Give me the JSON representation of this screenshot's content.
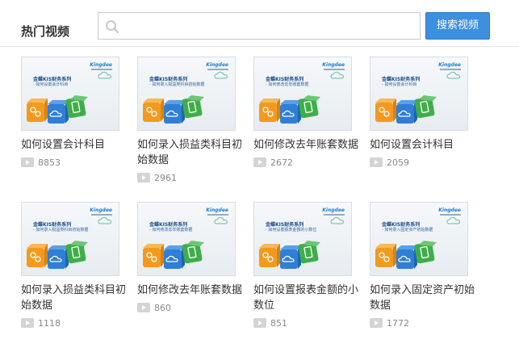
{
  "header": {
    "section_title": "热门视频",
    "search_placeholder": "",
    "search_button": "搜索视频"
  },
  "thumbnail": {
    "brand": "Kingdee",
    "series": "金蝶KIS财务系列",
    "icon_names": [
      "cloud-icon",
      "orange-cube-icon",
      "blue-cube-icon",
      "green-cube-icon"
    ]
  },
  "videos": [
    {
      "title": "如何设置会计科目",
      "subtitle": "- 如何设置会计科目",
      "views": "8853"
    },
    {
      "title": "如何录入损益类科目初始数据",
      "subtitle": "- 如何录入损益类科目初始数据",
      "views": "2961"
    },
    {
      "title": "如何修改去年账套数据",
      "subtitle": "- 如何修改去年账套数据",
      "views": "2672"
    },
    {
      "title": "如何设置会计科目",
      "subtitle": "- 如何设置会计科目",
      "views": "2059"
    },
    {
      "title": "如何录入损益类科目初始数据",
      "subtitle": "- 如何录入损益类科目初始数据",
      "views": "1118"
    },
    {
      "title": "如何修改去年账套数据",
      "subtitle": "- 如何修改去年账套数据",
      "views": "860"
    },
    {
      "title": "如何设置报表金额的小数位",
      "subtitle": "- 如何设置报表金额的小数位",
      "views": "851"
    },
    {
      "title": "如何录入固定资产初始数据",
      "subtitle": "- 如何录入固定资产初始数据",
      "views": "1772"
    }
  ],
  "colors": {
    "accent": "#3d8fe0",
    "cube_orange": "#f39a1e",
    "cube_blue": "#2f7fd6",
    "cube_green": "#3fae49"
  }
}
